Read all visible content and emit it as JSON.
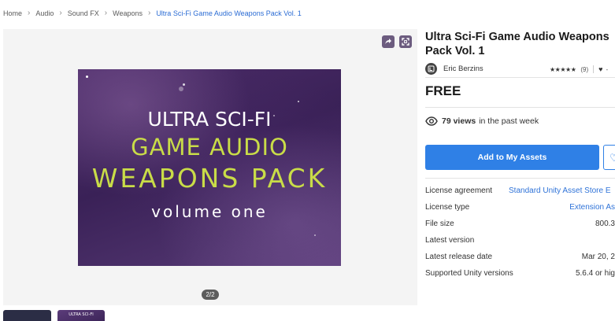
{
  "breadcrumb": {
    "items": [
      "Home",
      "Audio",
      "Sound FX",
      "Weapons"
    ],
    "current": "Ultra Sci-Fi Game Audio Weapons Pack Vol. 1",
    "separator": "›"
  },
  "media": {
    "share_icon": "share-icon",
    "expand_icon": "expand-icon",
    "hero_lines": [
      "ULTRA SCI-FI",
      "GAME AUDIO",
      "WEAPONS  PACK",
      "volume one"
    ],
    "counter": "2/2",
    "thumb2_text": "ULTRA SCI-FI"
  },
  "product": {
    "title": "Ultra Sci-Fi Game Audio Weapons Pack Vol. 1",
    "publisher": "Eric Berzins",
    "rating_stars": "★★★★★",
    "rating_count": "(9)",
    "favorites": "-",
    "price": "FREE",
    "views_count": "79 views",
    "views_suffix": "in the past week",
    "add_button": "Add to My Assets"
  },
  "info": {
    "license_agreement_label": "License agreement",
    "license_agreement_value": "Standard Unity Asset Store E",
    "license_type_label": "License type",
    "license_type_value": "Extension As",
    "file_size_label": "File size",
    "file_size_value": "800.3",
    "latest_version_label": "Latest version",
    "latest_version_value": "",
    "release_date_label": "Latest release date",
    "release_date_value": "Mar 20, 2",
    "unity_versions_label": "Supported Unity versions",
    "unity_versions_value": "5.6.4 or hig"
  },
  "colors": {
    "accent": "#2f80e6",
    "link": "#2f73d8",
    "hero_title_green": "#c9dc48",
    "hero_bg": "#3a2157"
  }
}
